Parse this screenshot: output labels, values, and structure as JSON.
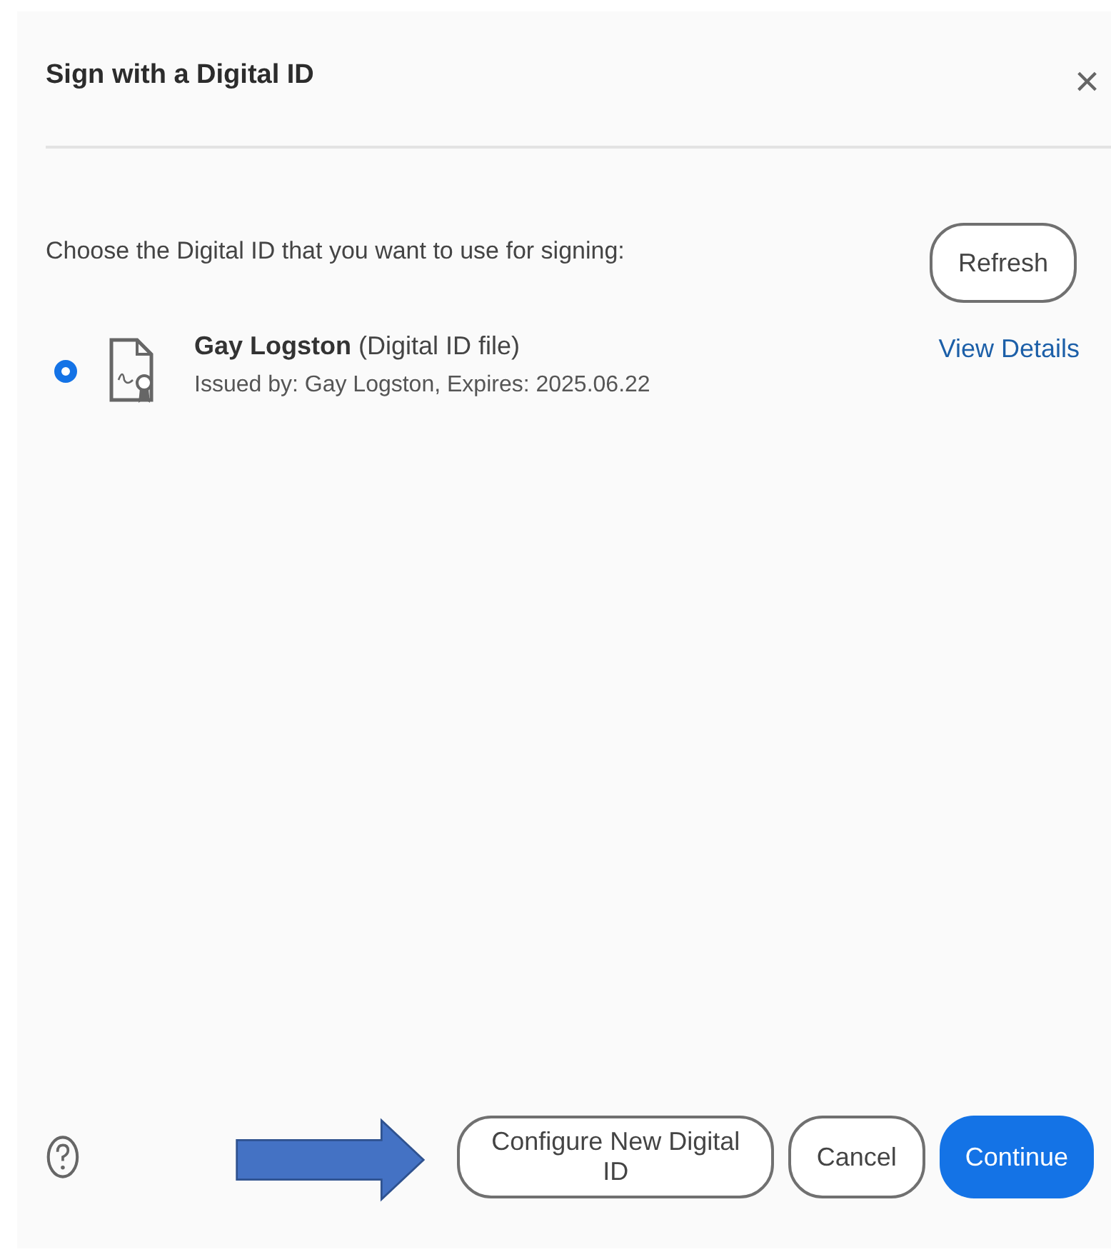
{
  "dialog": {
    "title": "Sign with a Digital ID",
    "close": "×"
  },
  "prompt": "Choose the Digital ID that you want to use for signing:",
  "refresh_button": "Refresh",
  "digital_ids": [
    {
      "name": "Gay Logston",
      "type": "(Digital ID file)",
      "details": "Issued by: Gay Logston, Expires: 2025.06.22",
      "link": "View Details",
      "selected": true
    }
  ],
  "footer_buttons": [
    {
      "label": "Configure New Digital ID",
      "kind": "secondary"
    },
    {
      "label": "Cancel",
      "kind": "secondary"
    },
    {
      "label": "Continue",
      "kind": "primary"
    }
  ]
}
